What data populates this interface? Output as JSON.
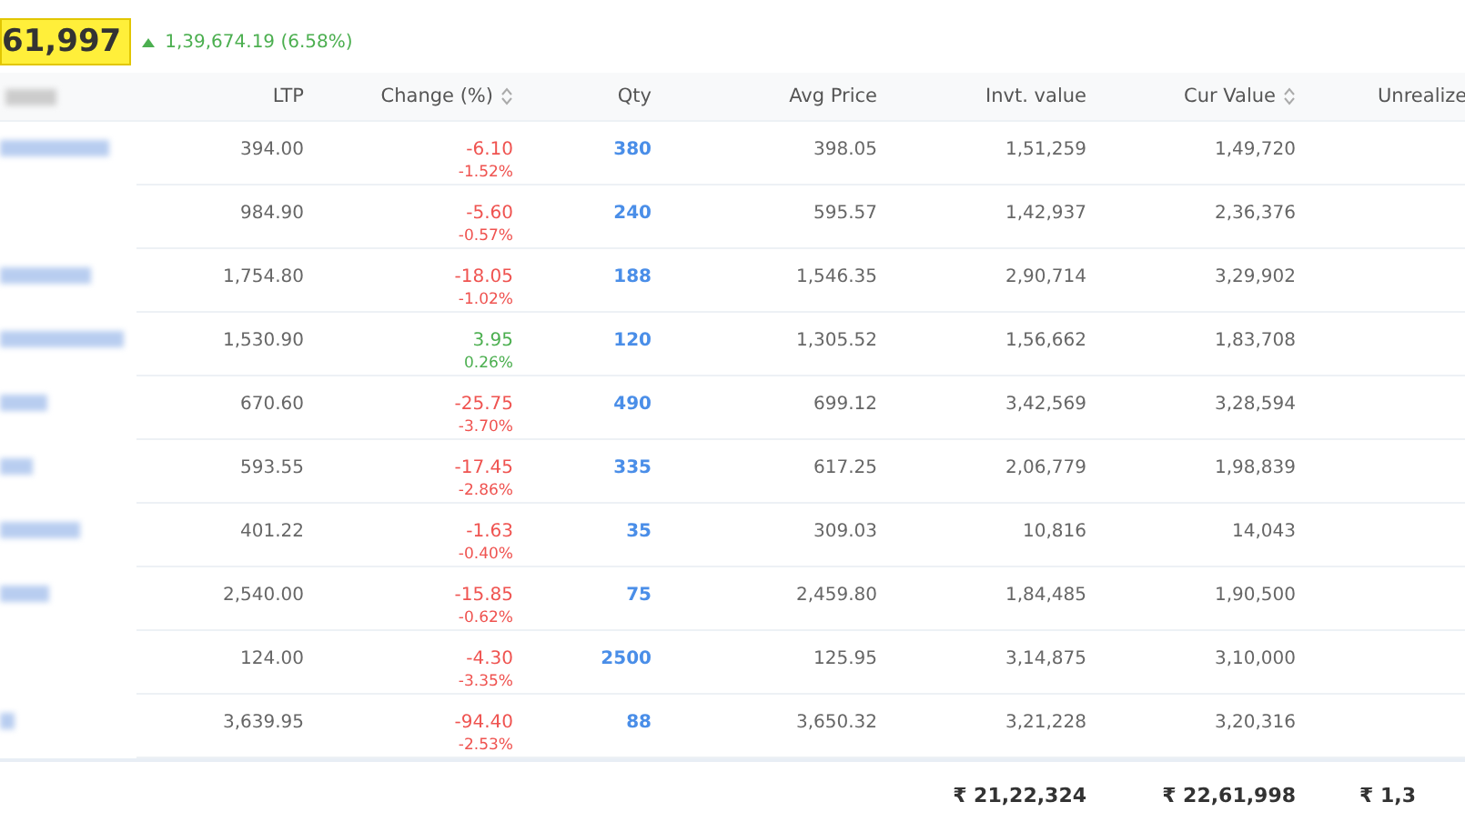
{
  "summary": {
    "total": "61,997",
    "change": "1,39,674.19 (6.58%)",
    "up": true
  },
  "table": {
    "columns": [
      {
        "label": "LTP",
        "sortable": false
      },
      {
        "label": "Change (%)",
        "sortable": true
      },
      {
        "label": "Qty",
        "sortable": false
      },
      {
        "label": "Avg Price",
        "sortable": false
      },
      {
        "label": "Invt. value",
        "sortable": false
      },
      {
        "label": "Cur Value",
        "sortable": true
      },
      {
        "label": "Unrealize"
      }
    ],
    "rows": [
      {
        "ltp": "394.00",
        "change": "-6.10",
        "change_pct": "-1.52%",
        "up": false,
        "qty": "380",
        "avg_price": "398.05",
        "invt_value": "1,51,259",
        "cur_value": "1,49,720"
      },
      {
        "ltp": "984.90",
        "change": "-5.60",
        "change_pct": "-0.57%",
        "up": false,
        "qty": "240",
        "avg_price": "595.57",
        "invt_value": "1,42,937",
        "cur_value": "2,36,376"
      },
      {
        "ltp": "1,754.80",
        "change": "-18.05",
        "change_pct": "-1.02%",
        "up": false,
        "qty": "188",
        "avg_price": "1,546.35",
        "invt_value": "2,90,714",
        "cur_value": "3,29,902"
      },
      {
        "ltp": "1,530.90",
        "change": "3.95",
        "change_pct": "0.26%",
        "up": true,
        "qty": "120",
        "avg_price": "1,305.52",
        "invt_value": "1,56,662",
        "cur_value": "1,83,708"
      },
      {
        "ltp": "670.60",
        "change": "-25.75",
        "change_pct": "-3.70%",
        "up": false,
        "qty": "490",
        "avg_price": "699.12",
        "invt_value": "3,42,569",
        "cur_value": "3,28,594"
      },
      {
        "ltp": "593.55",
        "change": "-17.45",
        "change_pct": "-2.86%",
        "up": false,
        "qty": "335",
        "avg_price": "617.25",
        "invt_value": "2,06,779",
        "cur_value": "1,98,839"
      },
      {
        "ltp": "401.22",
        "change": "-1.63",
        "change_pct": "-0.40%",
        "up": false,
        "qty": "35",
        "avg_price": "309.03",
        "invt_value": "10,816",
        "cur_value": "14,043"
      },
      {
        "ltp": "2,540.00",
        "change": "-15.85",
        "change_pct": "-0.62%",
        "up": false,
        "qty": "75",
        "avg_price": "2,459.80",
        "invt_value": "1,84,485",
        "cur_value": "1,90,500"
      },
      {
        "ltp": "124.00",
        "change": "-4.30",
        "change_pct": "-3.35%",
        "up": false,
        "qty": "2500",
        "avg_price": "125.95",
        "invt_value": "3,14,875",
        "cur_value": "3,10,000"
      },
      {
        "ltp": "3,639.95",
        "change": "-94.40",
        "change_pct": "-2.53%",
        "up": false,
        "qty": "88",
        "avg_price": "3,650.32",
        "invt_value": "3,21,228",
        "cur_value": "3,20,316"
      }
    ],
    "totals": {
      "invt_value": "₹ 21,22,324",
      "cur_value": "₹ 22,61,998",
      "unrealized": "₹ 1,3"
    }
  }
}
